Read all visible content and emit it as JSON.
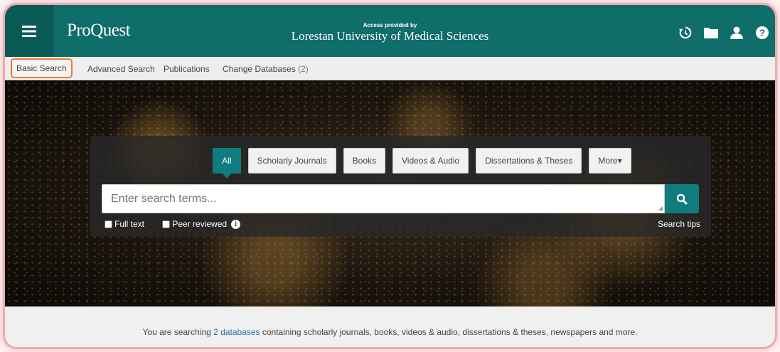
{
  "header": {
    "logo": "ProQuest",
    "access_small": "Access provided by",
    "institution": "Lorestan University of Medical Sciences",
    "icons": [
      "history-icon",
      "folder-icon",
      "user-icon",
      "help-icon"
    ]
  },
  "nav": {
    "basic_search": "Basic Search",
    "advanced_search": "Advanced Search",
    "publications": "Publications",
    "change_databases": "Change Databases",
    "databases_count": "(2)"
  },
  "search": {
    "tabs": [
      "All",
      "Scholarly Journals",
      "Books",
      "Videos & Audio",
      "Dissertations & Theses",
      "More▾"
    ],
    "placeholder": "Enter search terms...",
    "full_text": "Full text",
    "peer_reviewed": "Peer reviewed",
    "search_tips": "Search tips"
  },
  "footer": {
    "prefix": "You are searching ",
    "link": "2 databases",
    "suffix": " containing scholarly journals, books, videos & audio, dissertations & theses, newspapers and more."
  },
  "colors": {
    "brand": "#0f6d6a",
    "accent": "#0f7c80",
    "highlight": "#e97d2f"
  }
}
